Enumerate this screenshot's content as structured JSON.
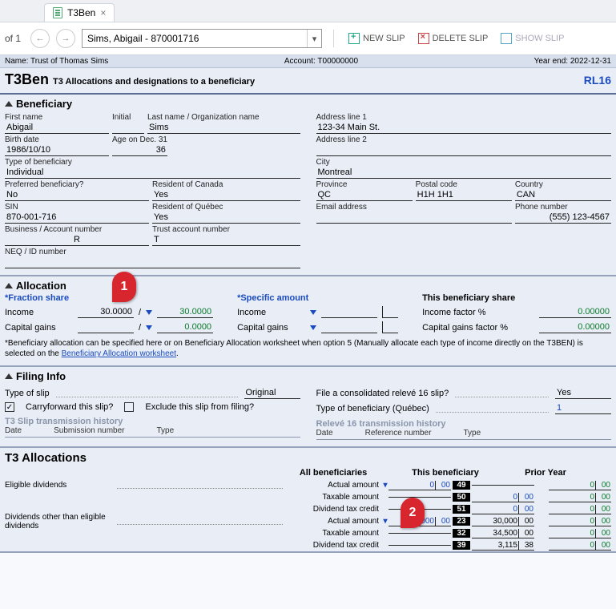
{
  "tab": {
    "title": "T3Ben"
  },
  "toolbar": {
    "of": "of 1",
    "combo": "Sims, Abigail - 870001716",
    "newslip": "NEW SLIP",
    "deleteslip": "DELETE SLIP",
    "showslip": "SHOW SLIP"
  },
  "meta": {
    "name": "Name: Trust of Thomas Sims",
    "account": "Account: T00000000",
    "yearend": "Year end: 2022-12-31"
  },
  "header": {
    "code": "T3Ben",
    "title": "T3 Allocations and designations to a beneficiary",
    "right": "RL16"
  },
  "beneficiary": {
    "title": "Beneficiary",
    "firstname_lbl": "First name",
    "firstname": "Abigail",
    "initial_lbl": "Initial",
    "initial": "",
    "lastname_lbl": "Last name / Organization name",
    "lastname": "Sims",
    "birth_lbl": "Birth date",
    "birth": "1986/10/10",
    "age_lbl": "Age on Dec. 31",
    "age": "36",
    "type_lbl": "Type of beneficiary",
    "type": "Individual",
    "pref_lbl": "Preferred beneficiary?",
    "pref": "No",
    "rescan_lbl": "Resident of Canada",
    "rescan": "Yes",
    "sin_lbl": "SIN",
    "sin": "870-001-716",
    "resqc_lbl": "Resident of Québec",
    "resqc": "Yes",
    "bus_lbl": "Business / Account number",
    "bus": "R",
    "trust_lbl": "Trust account number",
    "trust": "T",
    "neq_lbl": "NEQ / ID number",
    "neq": "",
    "addr1_lbl": "Address line 1",
    "addr1": "123-34 Main St.",
    "addr2_lbl": "Address line 2",
    "addr2": "",
    "city_lbl": "City",
    "city": "Montreal",
    "prov_lbl": "Province",
    "prov": "QC",
    "postal_lbl": "Postal code",
    "postal": "H1H 1H1",
    "country_lbl": "Country",
    "country": "CAN",
    "email_lbl": "Email address",
    "email": "",
    "phone_lbl": "Phone number",
    "phone": "(555) 123-4567"
  },
  "allocation": {
    "title": "Allocation",
    "fraction_lbl": "*Fraction share",
    "specific_lbl": "*Specific amount",
    "thisben_lbl": "This beneficiary share",
    "income_lbl": "Income",
    "capgains_lbl": "Capital gains",
    "income_num": "30.0000",
    "income_den": "30.0000",
    "cap_num": "",
    "cap_den": "0.0000",
    "spec_income": "",
    "spec_cap": "",
    "incfactor_lbl": "Income factor %",
    "incfactor": "0.00000",
    "capfactor_lbl": "Capital gains factor %",
    "capfactor": "0.00000",
    "note1": "*Beneficiary allocation can be specified here or on Beneficiary Allocation worksheet when option 5 (Manually allocate each type of income directly on the T3BEN) is selected on the ",
    "note_link": "Beneficiary Allocation worksheet",
    "note2": "."
  },
  "filing": {
    "title": "Filing Info",
    "typeslip_lbl": "Type of slip",
    "typeslip": "Original",
    "carryfwd": "Carryforward this slip?",
    "exclude": "Exclude this slip from filing?",
    "file16_lbl": "File a consolidated relevé 16 slip?",
    "file16": "Yes",
    "typeqc_lbl": "Type of beneficiary (Québec)",
    "typeqc": "1",
    "t3hist": "T3 Slip transmission history",
    "rl16hist": "Relevé 16 transmission history",
    "date": "Date",
    "subnum": "Submission number",
    "refnum": "Reference number",
    "type": "Type"
  },
  "t3a": {
    "title": "T3 Allocations",
    "h_all": "All beneficiaries",
    "h_this": "This beneficiary",
    "h_prior": "Prior Year",
    "r1": "Eligible dividends",
    "r2": "Dividends other than eligible dividends",
    "sub_actual": "Actual amount",
    "sub_taxable": "Taxable amount",
    "sub_credit": "Dividend tax credit",
    "rows": [
      {
        "lbl": "r1",
        "sub": "sub_actual",
        "all_v": "0",
        "all_c": "00",
        "box": "49",
        "this_v": "",
        "this_c": "",
        "py_v": "0",
        "py_c": "00"
      },
      {
        "lbl": "",
        "sub": "sub_taxable",
        "all_v": "",
        "all_c": "",
        "box": "50",
        "this_v": "0",
        "this_c": "00",
        "py_v": "0",
        "py_c": "00"
      },
      {
        "lbl": "",
        "sub": "sub_credit",
        "all_v": "",
        "all_c": "",
        "box": "51",
        "this_v": "0",
        "this_c": "00",
        "py_v": "0",
        "py_c": "00"
      },
      {
        "lbl": "r2",
        "sub": "sub_actual",
        "all_v": "30,000",
        "all_c": "00",
        "box": "23",
        "this_v": "30,000",
        "this_c": "00",
        "py_v": "0",
        "py_c": "00"
      },
      {
        "lbl": "",
        "sub": "sub_taxable",
        "all_v": "",
        "all_c": "",
        "box": "32",
        "this_v": "34,500",
        "this_c": "00",
        "py_v": "0",
        "py_c": "00"
      },
      {
        "lbl": "",
        "sub": "sub_credit",
        "all_v": "",
        "all_c": "",
        "box": "39",
        "this_v": "3,115",
        "this_c": "38",
        "py_v": "0",
        "py_c": "00"
      }
    ]
  },
  "callouts": {
    "c1": "1",
    "c2": "2"
  }
}
